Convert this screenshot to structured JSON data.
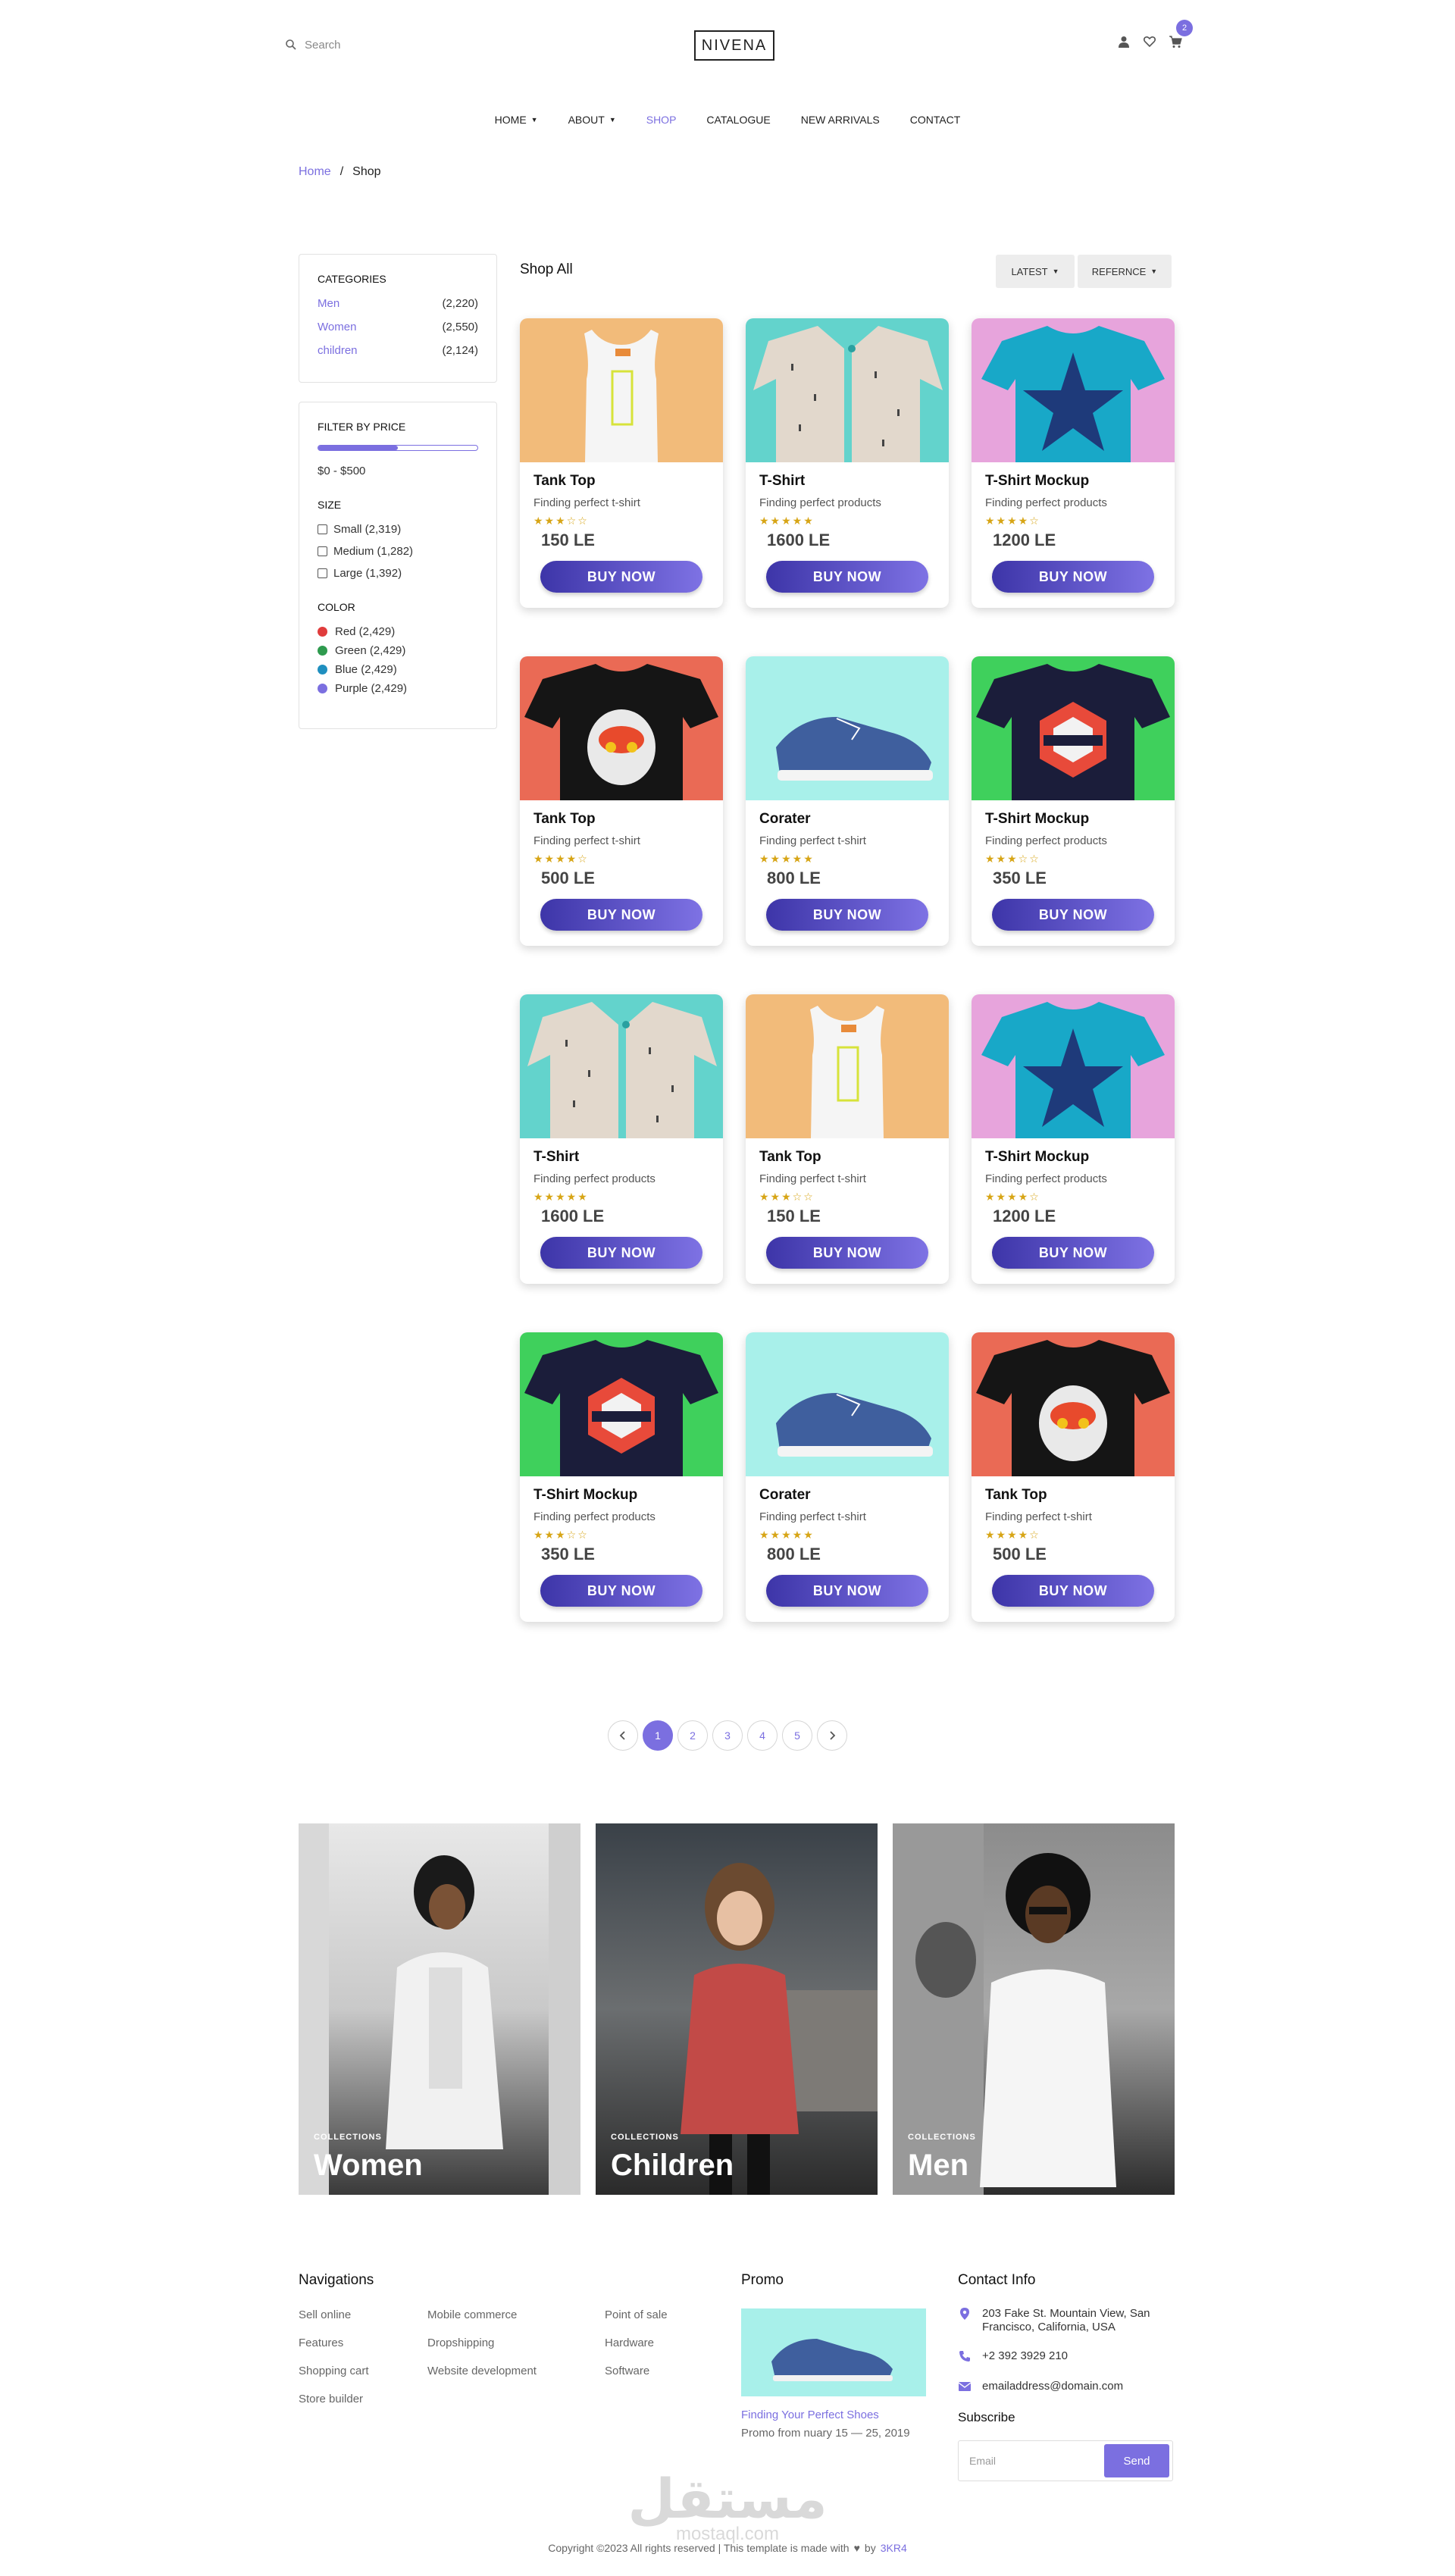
{
  "header": {
    "search_placeholder": "Search",
    "logo": "NIVENA",
    "cart_count": "2"
  },
  "nav": [
    {
      "label": "HOME",
      "dropdown": true,
      "active": false
    },
    {
      "label": "ABOUT",
      "dropdown": true,
      "active": false
    },
    {
      "label": "SHOP",
      "dropdown": false,
      "active": true
    },
    {
      "label": "CATALOGUE",
      "dropdown": false,
      "active": false
    },
    {
      "label": "NEW ARRIVALS",
      "dropdown": false,
      "active": false
    },
    {
      "label": "CONTACT",
      "dropdown": false,
      "active": false
    }
  ],
  "breadcrumb": {
    "home": "Home",
    "sep": "/",
    "current": "Shop"
  },
  "sidebar": {
    "categories_title": "CATEGORIES",
    "categories": [
      {
        "name": "Men",
        "count": "(2,220)"
      },
      {
        "name": "Women",
        "count": "(2,550)"
      },
      {
        "name": "children",
        "count": "(2,124)"
      }
    ],
    "filter_title": "FILTER BY PRICE",
    "price_fill_fraction": 0.5,
    "price_range": "$0 - $500",
    "size_title": "SIZE",
    "sizes": [
      "Small (2,319)",
      "Medium (1,282)",
      "Large (1,392)"
    ],
    "color_title": "COLOR",
    "colors": [
      {
        "label": "Red (2,429)",
        "hex": "#e03c3c"
      },
      {
        "label": "Green (2,429)",
        "hex": "#2e9a4e"
      },
      {
        "label": "Blue (2,429)",
        "hex": "#1f8fbf"
      },
      {
        "label": "Purple (2,429)",
        "hex": "#7b6fe0"
      }
    ]
  },
  "shop": {
    "title": "Shop All",
    "sort1": "LATEST",
    "sort2": "REFERNCE"
  },
  "products": [
    {
      "title": "Tank Top",
      "desc": "Finding perfect t-shirt",
      "stars": "★★★☆☆",
      "price": "150 LE",
      "buy": "BUY NOW",
      "image": "tank-top",
      "bg": "#f2bb7a"
    },
    {
      "title": "T-Shirt",
      "desc": "Finding perfect products",
      "stars": "★★★★★",
      "price": "1600 LE",
      "buy": "BUY NOW",
      "image": "shirt-beige",
      "bg": "#63d3cc"
    },
    {
      "title": "T-Shirt Mockup",
      "desc": "Finding perfect products",
      "stars": "★★★★☆",
      "price": "1200 LE",
      "buy": "BUY NOW",
      "image": "tshirt-cyan-star",
      "bg": "#e7a4dc"
    },
    {
      "title": "Tank Top",
      "desc": "Finding perfect t-shirt",
      "stars": "★★★★☆",
      "price": "500 LE",
      "buy": "BUY NOW",
      "image": "tshirt-black-print",
      "bg": "#ea6a55"
    },
    {
      "title": "Corater",
      "desc": "Finding perfect t-shirt",
      "stars": "★★★★★",
      "price": "800 LE",
      "buy": "BUY NOW",
      "image": "sneaker-blue",
      "bg": "#a8f0ea"
    },
    {
      "title": "T-Shirt Mockup",
      "desc": "Finding perfect products",
      "stars": "★★★☆☆",
      "price": "350 LE",
      "buy": "BUY NOW",
      "image": "tshirt-navy-california",
      "bg": "#3fd05c"
    },
    {
      "title": "T-Shirt",
      "desc": "Finding perfect products",
      "stars": "★★★★★",
      "price": "1600 LE",
      "buy": "BUY NOW",
      "image": "shirt-beige",
      "bg": "#63d3cc"
    },
    {
      "title": "Tank Top",
      "desc": "Finding perfect t-shirt",
      "stars": "★★★☆☆",
      "price": "150 LE",
      "buy": "BUY NOW",
      "image": "tank-top",
      "bg": "#f2bb7a"
    },
    {
      "title": "T-Shirt Mockup",
      "desc": "Finding perfect products",
      "stars": "★★★★☆",
      "price": "1200 LE",
      "buy": "BUY NOW",
      "image": "tshirt-cyan-star",
      "bg": "#e7a4dc"
    },
    {
      "title": "T-Shirt Mockup",
      "desc": "Finding perfect products",
      "stars": "★★★☆☆",
      "price": "350 LE",
      "buy": "BUY NOW",
      "image": "tshirt-navy-california",
      "bg": "#3fd05c"
    },
    {
      "title": "Corater",
      "desc": "Finding perfect t-shirt",
      "stars": "★★★★★",
      "price": "800 LE",
      "buy": "BUY NOW",
      "image": "sneaker-blue",
      "bg": "#a8f0ea"
    },
    {
      "title": "Tank Top",
      "desc": "Finding perfect t-shirt",
      "stars": "★★★★☆",
      "price": "500 LE",
      "buy": "BUY NOW",
      "image": "tshirt-black-print",
      "bg": "#ea6a55"
    }
  ],
  "pagination": {
    "pages": [
      "1",
      "2",
      "3",
      "4",
      "5"
    ],
    "active": "1"
  },
  "collections": [
    {
      "small": "COLLECTIONS",
      "big": "Women"
    },
    {
      "small": "COLLECTIONS",
      "big": "Children"
    },
    {
      "small": "COLLECTIONS",
      "big": "Men"
    }
  ],
  "footer": {
    "nav_title": "Navigations",
    "col1": [
      "Sell online",
      "Features",
      "Shopping cart",
      "Store builder"
    ],
    "col2": [
      "Mobile commerce",
      "Dropshipping",
      "Website development"
    ],
    "col3": [
      "Point of sale",
      "Hardware",
      "Software"
    ],
    "promo_title": "Promo",
    "promo_link": "Finding Your Perfect Shoes",
    "promo_text": "Promo from nuary 15 — 25, 2019",
    "contact_title": "Contact Info",
    "address": "203 Fake St. Mountain View, San Francisco, California, USA",
    "phone": "+2 392 3929 210",
    "email": "emailaddress@domain.com",
    "subscribe_title": "Subscribe",
    "email_placeholder": "Email",
    "send": "Send",
    "copyright_prefix": "Copyright ©2023 All rights reserved | This template is made with",
    "copyright_by": "by",
    "author": "3KR4",
    "watermark": "مستقل",
    "watermark_sub": "mostaql.com"
  },
  "colors": {
    "accent": "#7b6fe0",
    "button_start": "#3d35a8",
    "button_end": "#7e72e4",
    "star": "#d7a516"
  }
}
